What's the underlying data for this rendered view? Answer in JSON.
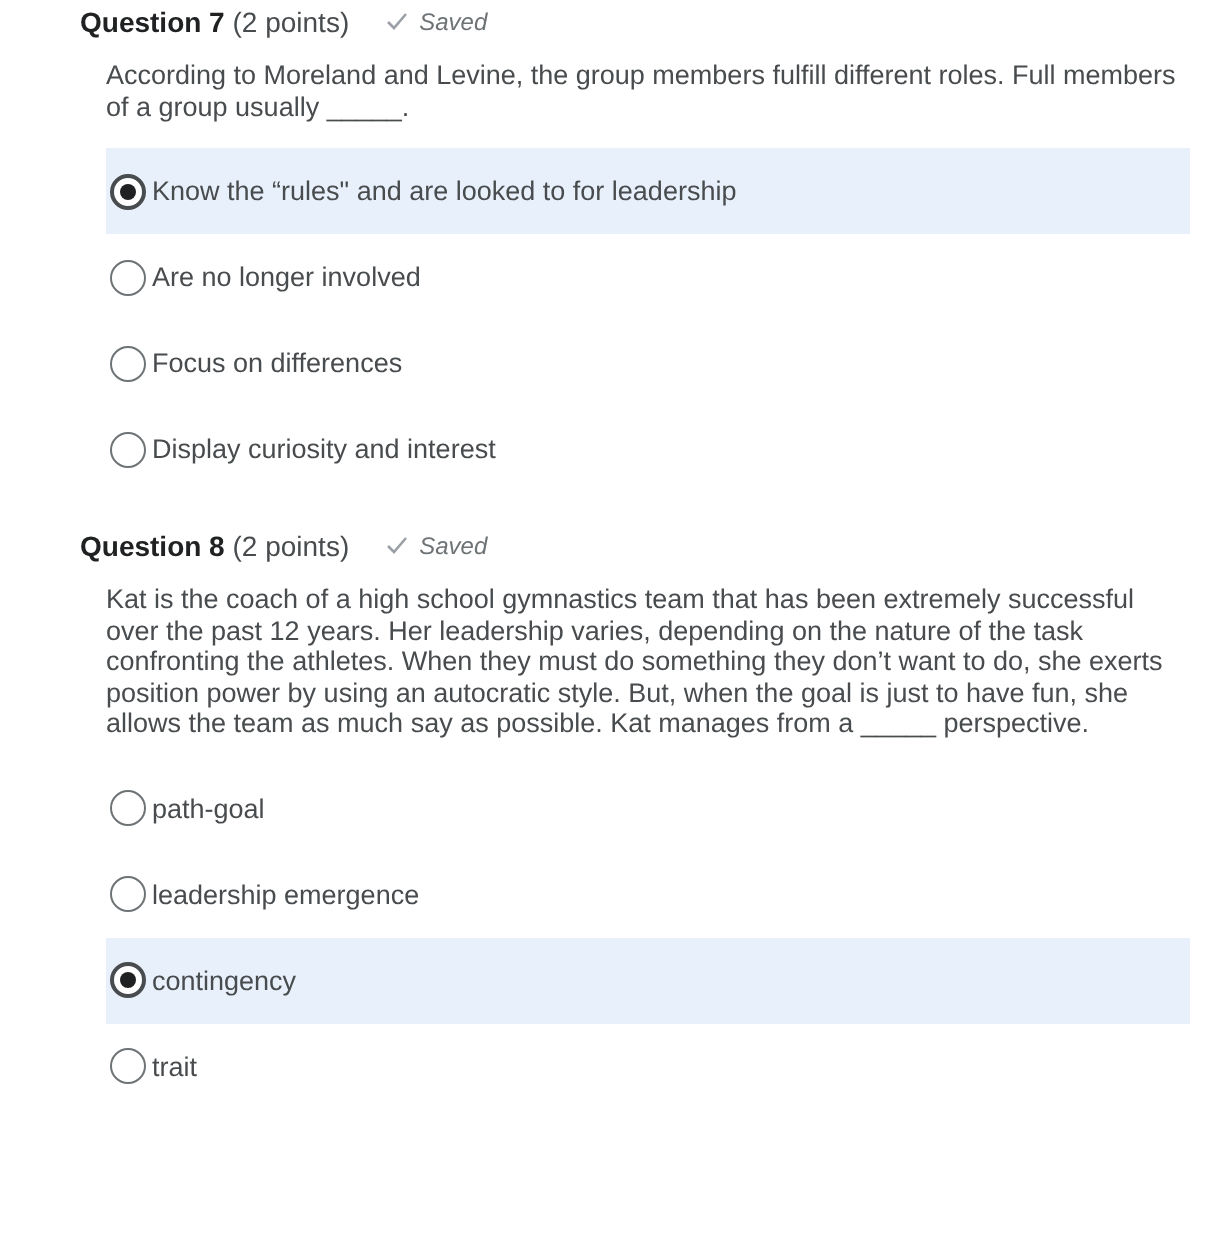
{
  "questions": [
    {
      "title": "**Question 7** (2 points)",
      "status": "Saved",
      "prompt": "According to Moreland and Levine, the group members fulfill different roles. Full members of a group usually _____.",
      "options": [
        {
          "label": "Know the “rules\" and are looked to for leadership",
          "selected": true
        },
        {
          "label": "Are no longer involved",
          "selected": false
        },
        {
          "label": "Focus on differences",
          "selected": false
        },
        {
          "label": "Display curiosity and interest",
          "selected": false
        }
      ]
    },
    {
      "title": "**Question 8** (2 points)",
      "status": "Saved",
      "prompt": "Kat is the coach of a high school gymnastics team that has been extremely successful over the past 12 years. Her leadership varies, depending on the nature of the task confronting the athletes. When they must do something they don’t want to do, she exerts position power by using an autocratic style. But, when the goal is just to have fun, she allows the team as much say as possible. Kat manages from a _____ perspective.",
      "options": [
        {
          "label": "path-goal",
          "selected": false
        },
        {
          "label": "leadership emergence",
          "selected": false
        },
        {
          "label": "contingency",
          "selected": true
        },
        {
          "label": "trait",
          "selected": false
        }
      ]
    }
  ]
}
